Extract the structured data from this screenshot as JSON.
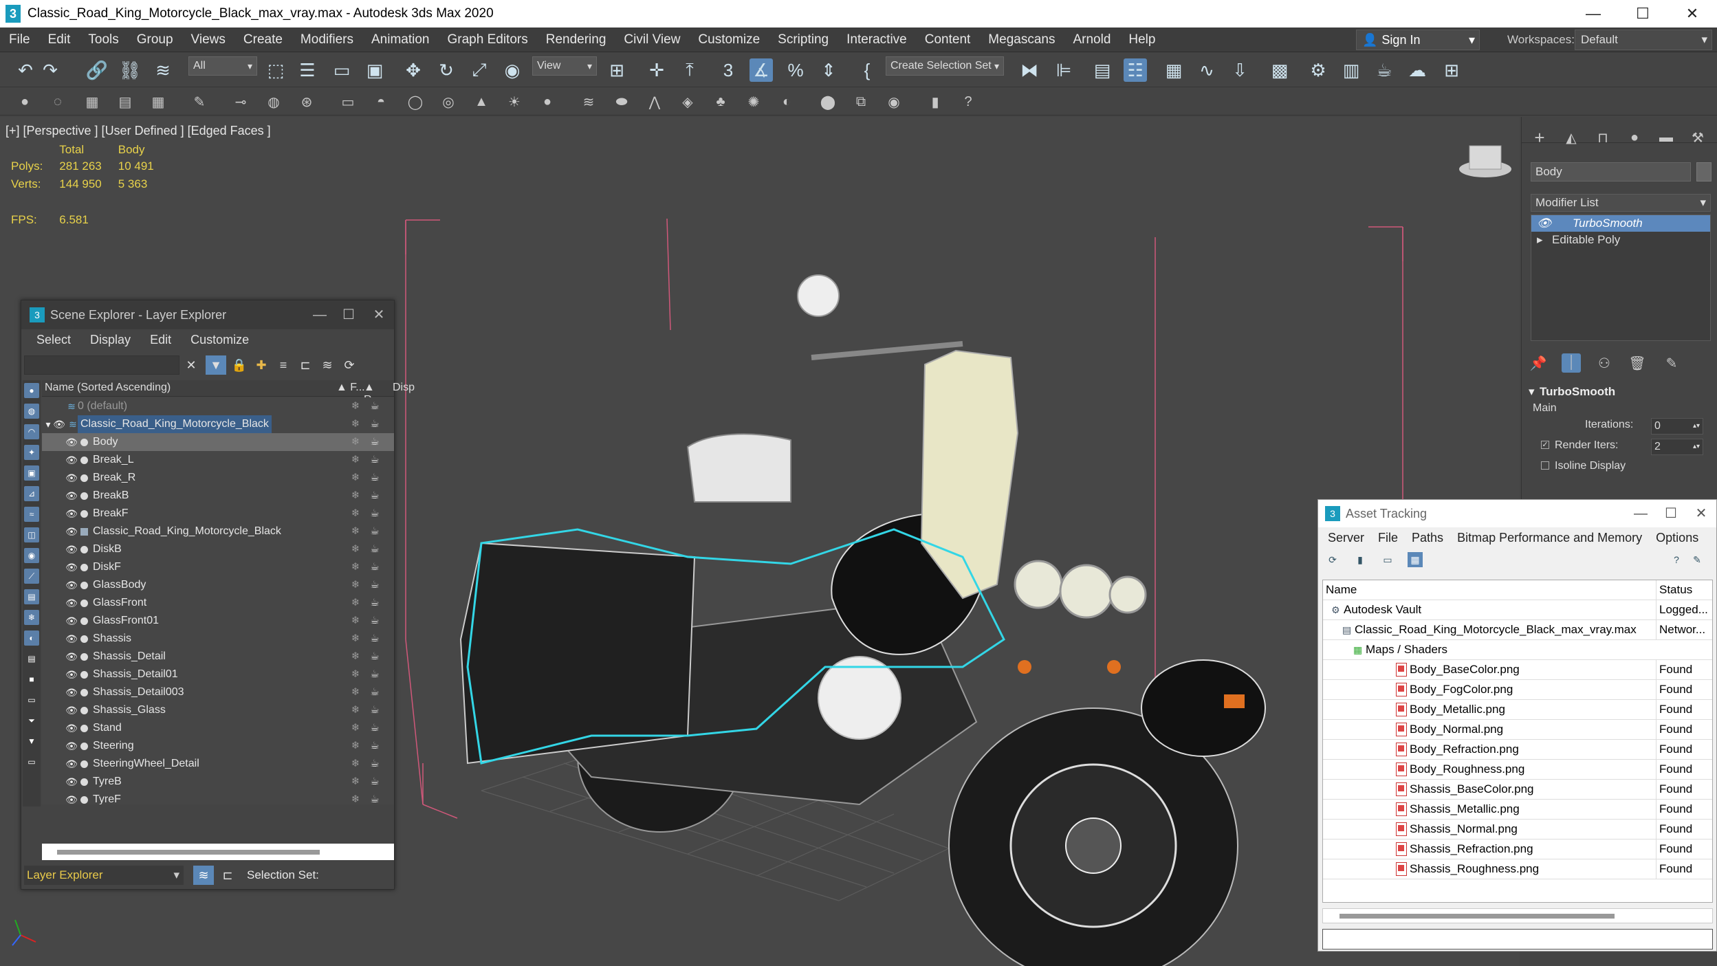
{
  "window": {
    "title": "Classic_Road_King_Motorcycle_Black_max_vray.max - Autodesk 3ds Max 2020",
    "app_icon": "3",
    "minimize": "—",
    "maximize": "☐",
    "close": "✕"
  },
  "menu": [
    "File",
    "Edit",
    "Tools",
    "Group",
    "Views",
    "Create",
    "Modifiers",
    "Animation",
    "Graph Editors",
    "Rendering",
    "Civil View",
    "Customize",
    "Scripting",
    "Interactive",
    "Content",
    "Megascans",
    "Arnold",
    "Help"
  ],
  "signin": {
    "label": "Sign In"
  },
  "workspaces": {
    "label": "Workspaces:",
    "value": "Default"
  },
  "toolbar": {
    "filter_value": "All",
    "refcoord_value": "View",
    "selection_set_value": "Create Selection Set",
    "snap_label": "3"
  },
  "viewport": {
    "label": "[+] [Perspective ] [User Defined ] [Edged Faces ]",
    "stats": {
      "col_total": "Total",
      "col_body": "Body",
      "polys_label": "Polys:",
      "polys_total": "281 263",
      "polys_body": "10 491",
      "verts_label": "Verts:",
      "verts_total": "144 950",
      "verts_body": "5 363",
      "fps_label": "FPS:",
      "fps_value": "6.581"
    }
  },
  "scene_explorer": {
    "title": "Scene Explorer - Layer Explorer",
    "menu": [
      "Select",
      "Display",
      "Edit",
      "Customize"
    ],
    "col_name": "Name (Sorted Ascending)",
    "col_frozen": "▲ F...",
    "col_render": "▲ R...",
    "col_disp": "Disp",
    "rows": [
      {
        "name": "0 (default)",
        "level": 0,
        "type": "layer-default"
      },
      {
        "name": "Classic_Road_King_Motorcycle_Black",
        "level": 0,
        "type": "layer"
      },
      {
        "name": "Body",
        "level": 1,
        "type": "object",
        "selected": true
      },
      {
        "name": "Break_L",
        "level": 1,
        "type": "object"
      },
      {
        "name": "Break_R",
        "level": 1,
        "type": "object"
      },
      {
        "name": "BreakB",
        "level": 1,
        "type": "object"
      },
      {
        "name": "BreakF",
        "level": 1,
        "type": "object"
      },
      {
        "name": "Classic_Road_King_Motorcycle_Black",
        "level": 1,
        "type": "group"
      },
      {
        "name": "DiskB",
        "level": 1,
        "type": "object"
      },
      {
        "name": "DiskF",
        "level": 1,
        "type": "object"
      },
      {
        "name": "GlassBody",
        "level": 1,
        "type": "object"
      },
      {
        "name": "GlassFront",
        "level": 1,
        "type": "object"
      },
      {
        "name": "GlassFront01",
        "level": 1,
        "type": "object"
      },
      {
        "name": "Shassis",
        "level": 1,
        "type": "object"
      },
      {
        "name": "Shassis_Detail",
        "level": 1,
        "type": "object"
      },
      {
        "name": "Shassis_Detail01",
        "level": 1,
        "type": "object"
      },
      {
        "name": "Shassis_Detail003",
        "level": 1,
        "type": "object"
      },
      {
        "name": "Shassis_Glass",
        "level": 1,
        "type": "object"
      },
      {
        "name": "Stand",
        "level": 1,
        "type": "object"
      },
      {
        "name": "Steering",
        "level": 1,
        "type": "object"
      },
      {
        "name": "SteeringWheel_Detail",
        "level": 1,
        "type": "object"
      },
      {
        "name": "TyreB",
        "level": 1,
        "type": "object"
      },
      {
        "name": "TyreF",
        "level": 1,
        "type": "object"
      }
    ],
    "footer_explorer": "Layer Explorer",
    "footer_selection_set": "Selection Set:"
  },
  "command_panel": {
    "object_name": "Body",
    "modifier_list": "Modifier List",
    "stack": [
      {
        "name": "TurboSmooth",
        "selected": true
      },
      {
        "name": "Editable Poly",
        "selected": false
      }
    ],
    "rollout_title": "TurboSmooth",
    "main_label": "Main",
    "iterations_label": "Iterations:",
    "iterations_value": "0",
    "render_iters_label": "Render Iters:",
    "render_iters_value": "2",
    "isoline_label": "Isoline Display"
  },
  "asset_tracking": {
    "title": "Asset Tracking",
    "menu": [
      "Server",
      "File",
      "Paths",
      "Bitmap Performance and Memory",
      "Options"
    ],
    "col_name": "Name",
    "col_status": "Status",
    "rows": [
      {
        "name": "Autodesk Vault",
        "status": "Logged...",
        "level": 0,
        "icon": "vault"
      },
      {
        "name": "Classic_Road_King_Motorcycle_Black_max_vray.max",
        "status": "Networ...",
        "level": 1,
        "icon": "max"
      },
      {
        "name": "Maps / Shaders",
        "status": "",
        "level": 2,
        "icon": "folder"
      },
      {
        "name": "Body_BaseColor.png",
        "status": "Found",
        "level": 3,
        "icon": "png"
      },
      {
        "name": "Body_FogColor.png",
        "status": "Found",
        "level": 3,
        "icon": "png"
      },
      {
        "name": "Body_Metallic.png",
        "status": "Found",
        "level": 3,
        "icon": "png"
      },
      {
        "name": "Body_Normal.png",
        "status": "Found",
        "level": 3,
        "icon": "png"
      },
      {
        "name": "Body_Refraction.png",
        "status": "Found",
        "level": 3,
        "icon": "png"
      },
      {
        "name": "Body_Roughness.png",
        "status": "Found",
        "level": 3,
        "icon": "png"
      },
      {
        "name": "Shassis_BaseColor.png",
        "status": "Found",
        "level": 3,
        "icon": "png"
      },
      {
        "name": "Shassis_Metallic.png",
        "status": "Found",
        "level": 3,
        "icon": "png"
      },
      {
        "name": "Shassis_Normal.png",
        "status": "Found",
        "level": 3,
        "icon": "png"
      },
      {
        "name": "Shassis_Refraction.png",
        "status": "Found",
        "level": 3,
        "icon": "png"
      },
      {
        "name": "Shassis_Roughness.png",
        "status": "Found",
        "level": 3,
        "icon": "png"
      }
    ]
  },
  "colors": {
    "accent": "#5b88b8",
    "selection_outline": "#33d6e6",
    "stats_text": "#e8d24a",
    "bbox": "#d0587a"
  }
}
